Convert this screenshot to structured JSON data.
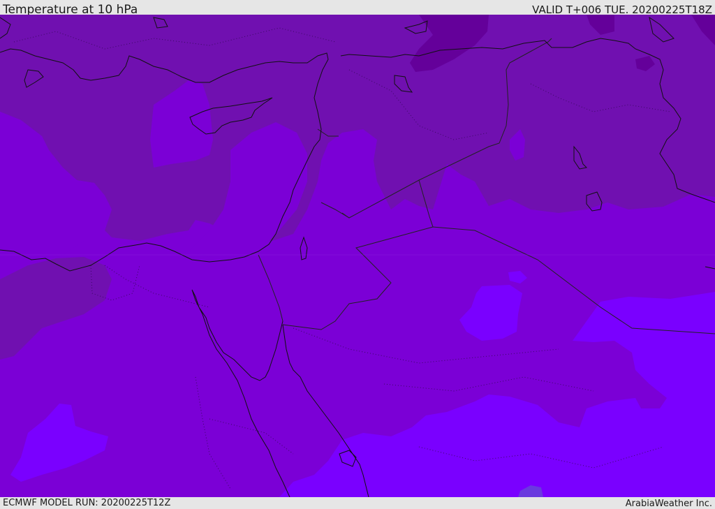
{
  "header": {
    "title": "Temperature at 10 hPa",
    "valid_time": "VALID T+006 TUE. 20200225T18Z"
  },
  "footer": {
    "model_run": "ECMWF MODEL RUN: 20200225T12Z",
    "credit": "ArabiaWeather Inc."
  },
  "map": {
    "colors": {
      "darkest_band": "#64009a",
      "dark_band": "#7010b0",
      "mid_band": "#7b00d6",
      "light_band": "#7a00ff",
      "lightest_band": "#7f10ff",
      "coastline": "#111111",
      "border": "#222222"
    }
  }
}
